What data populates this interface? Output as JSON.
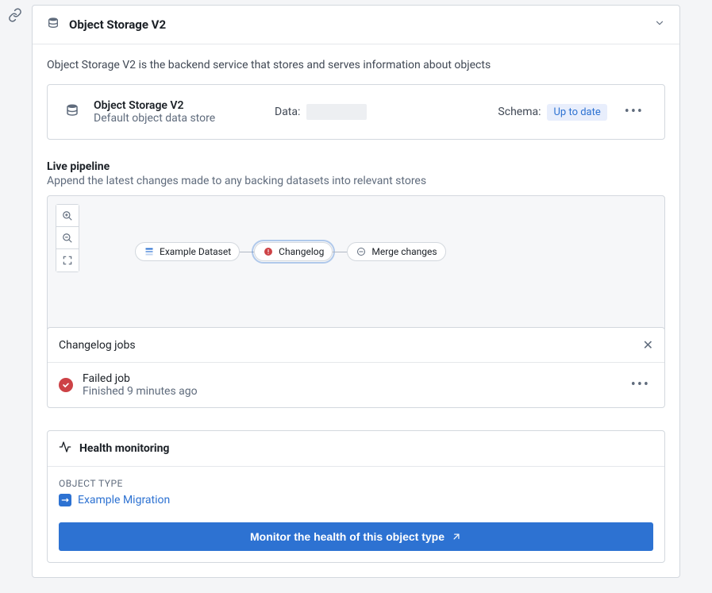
{
  "header": {
    "title": "Object Storage V2",
    "description": "Object Storage V2 is the backend service that stores and serves information about objects"
  },
  "store": {
    "name": "Object Storage V2",
    "subtitle": "Default object data store",
    "data_label": "Data:",
    "schema_label": "Schema:",
    "schema_status": "Up to date"
  },
  "pipeline": {
    "title": "Live pipeline",
    "subtitle": "Append the latest changes made to any backing datasets into relevant stores",
    "nodes": [
      {
        "label": "Example Dataset",
        "icon": "dataset",
        "selected": false
      },
      {
        "label": "Changelog",
        "icon": "error",
        "selected": true
      },
      {
        "label": "Merge changes",
        "icon": "merge",
        "selected": false
      }
    ]
  },
  "changelog": {
    "title": "Changelog jobs",
    "job_title": "Failed job",
    "job_subtitle": "Finished 9 minutes ago"
  },
  "health": {
    "title": "Health monitoring",
    "object_type_label": "OBJECT TYPE",
    "object_type_name": "Example Migration",
    "button_label": "Monitor the health of this object type"
  }
}
